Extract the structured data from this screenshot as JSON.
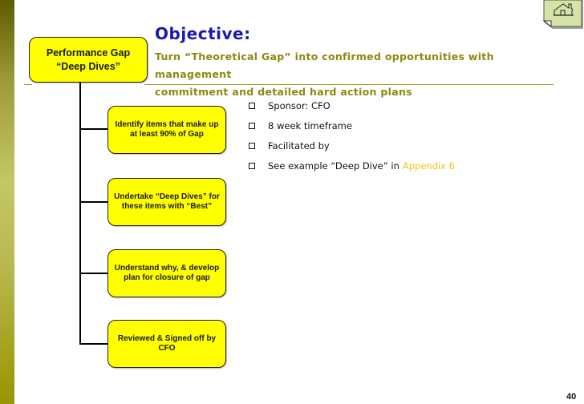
{
  "slide": {
    "objective_title": "Objective:",
    "objective_line1": "Turn “Theoretical Gap” into confirmed opportunities with management",
    "objective_line2": "commitment and detailed hard action plans",
    "page_number": "40"
  },
  "home_button": {
    "icon": "home-icon",
    "color": "#d5e3a6"
  },
  "diagram": {
    "root": {
      "line1": "Performance Gap",
      "line2": "“Deep Dives”"
    },
    "steps": [
      {
        "label": "Identify items that make up at least 90% of Gap"
      },
      {
        "label": "Undertake “Deep Dives” for these items with “Best”"
      },
      {
        "label": "Understand why, & develop plan for closure of gap"
      },
      {
        "label": "Reviewed & Signed off by CFO"
      }
    ]
  },
  "bullets": [
    {
      "text": "Sponsor: CFO"
    },
    {
      "text": "8 week timeframe"
    },
    {
      "text": "Facilitated by"
    },
    {
      "text": "See example “Deep Dive” in",
      "link": "Appendix 6"
    }
  ],
  "colors": {
    "title": "#1a1ab0",
    "objective_text": "#8a8a10",
    "box_fill": "#ffff00",
    "link": "#f5c21b",
    "side_bar": "#999500"
  }
}
